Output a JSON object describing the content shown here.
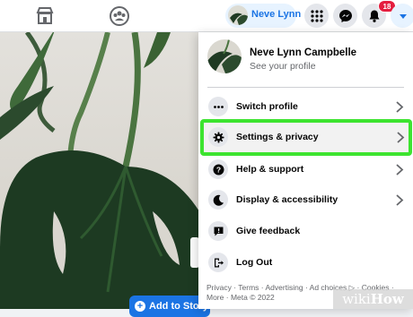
{
  "topbar": {
    "profile_chip_name": "Neve Lynn",
    "notification_count": "18",
    "icons": [
      "marketplace-icon",
      "groups-icon",
      "apps-grid-icon",
      "messenger-icon",
      "bell-icon",
      "chevron-down-icon"
    ]
  },
  "menu": {
    "profile": {
      "name": "Neve Lynn Campbelle",
      "subtitle": "See your profile"
    },
    "items": [
      {
        "label": "Switch profile",
        "icon": "more-dots-icon",
        "has_chevron": true
      },
      {
        "label": "Settings & privacy",
        "icon": "gear-icon",
        "has_chevron": true,
        "highlighted": true
      },
      {
        "label": "Help & support",
        "icon": "question-icon",
        "has_chevron": true
      },
      {
        "label": "Display & accessibility",
        "icon": "moon-icon",
        "has_chevron": true
      },
      {
        "label": "Give feedback",
        "icon": "feedback-icon",
        "has_chevron": false
      },
      {
        "label": "Log Out",
        "icon": "logout-icon",
        "has_chevron": false
      }
    ],
    "footer": {
      "links": [
        "Privacy",
        "Terms",
        "Advertising",
        "Ad choices",
        "Cookies",
        "More"
      ],
      "copyright": "Meta © 2022"
    }
  },
  "story": {
    "add_button_label": "Add to Story"
  },
  "watermark": {
    "wiki": "wiki",
    "how": "How"
  },
  "colors": {
    "accent": "#1b74e4",
    "highlight": "#3de430",
    "badge": "#e41e3f"
  }
}
